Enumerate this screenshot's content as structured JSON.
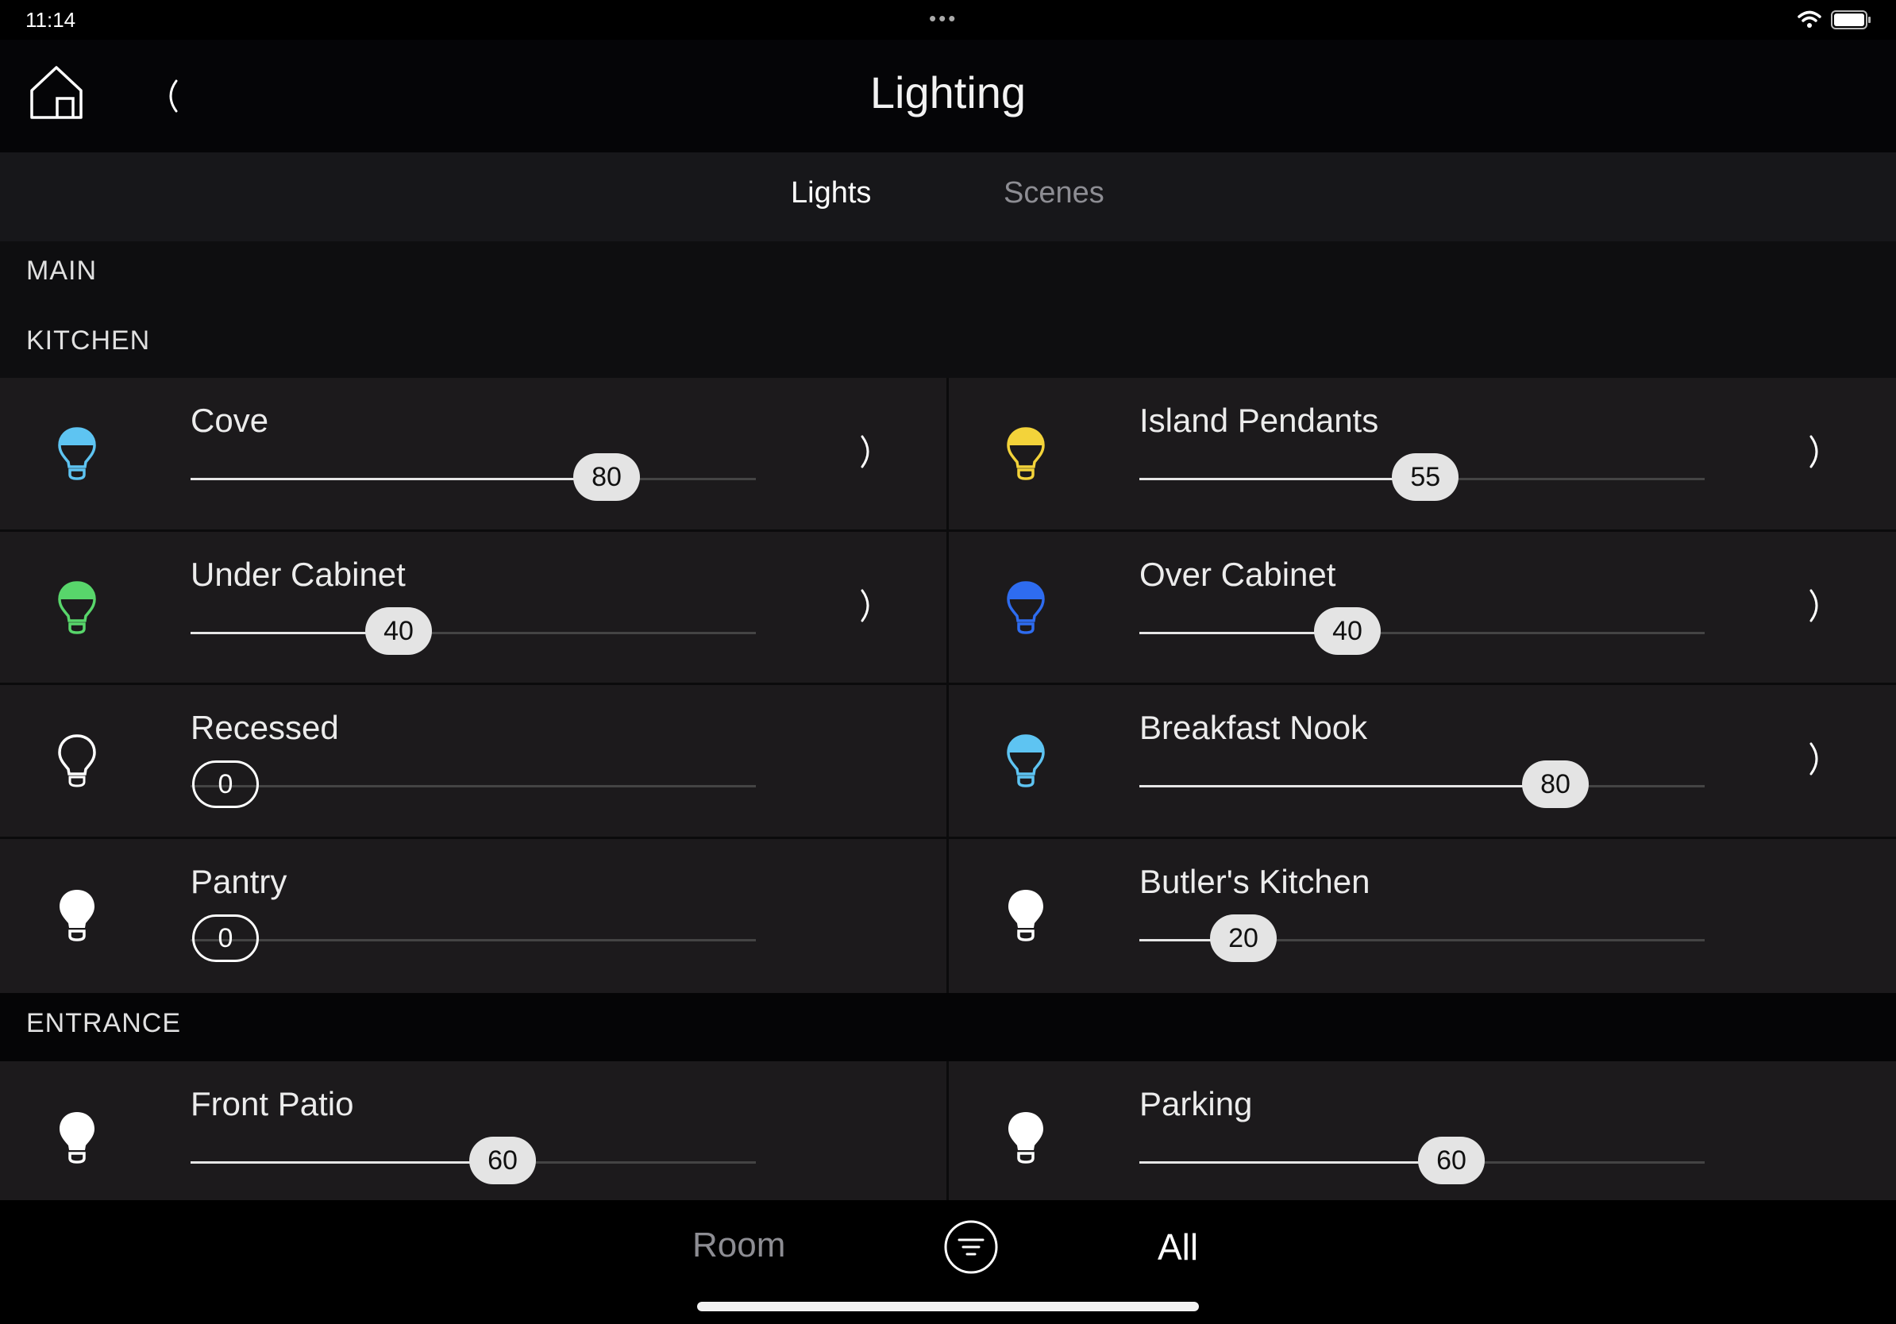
{
  "status": {
    "time": "11:14",
    "dots": "•••"
  },
  "header": {
    "title": "Lighting"
  },
  "tabs": {
    "lights": "Lights",
    "scenes": "Scenes"
  },
  "sections": {
    "main": "MAIN",
    "kitchen": "KITCHEN",
    "entrance": "ENTRANCE"
  },
  "colors": {
    "cyan": "#5ec4f2",
    "yellow": "#f3d33a",
    "green": "#58d66b",
    "blue": "#2e6cf0",
    "white": "#ffffff"
  },
  "kitchen": [
    {
      "name": "Cove",
      "level": 80,
      "bulb": "cyan",
      "chevron": true
    },
    {
      "name": "Island Pendants",
      "level": 55,
      "bulb": "yellow",
      "chevron": true
    },
    {
      "name": "Under Cabinet",
      "level": 40,
      "bulb": "green",
      "chevron": true
    },
    {
      "name": "Over Cabinet",
      "level": 40,
      "bulb": "blue",
      "chevron": true
    },
    {
      "name": "Recessed",
      "level": 0,
      "bulb": "off",
      "chevron": false
    },
    {
      "name": "Breakfast Nook",
      "level": 80,
      "bulb": "cyan",
      "chevron": true
    },
    {
      "name": "Pantry",
      "level": 0,
      "bulb": "white",
      "chevron": false
    },
    {
      "name": "Butler's Kitchen",
      "level": 20,
      "bulb": "white",
      "chevron": false
    }
  ],
  "entrance": [
    {
      "name": "Front Patio",
      "level": 60,
      "bulb": "white",
      "chevron": false
    },
    {
      "name": "Parking",
      "level": 60,
      "bulb": "white",
      "chevron": false
    }
  ],
  "bottom": {
    "room": "Room",
    "all": "All"
  }
}
